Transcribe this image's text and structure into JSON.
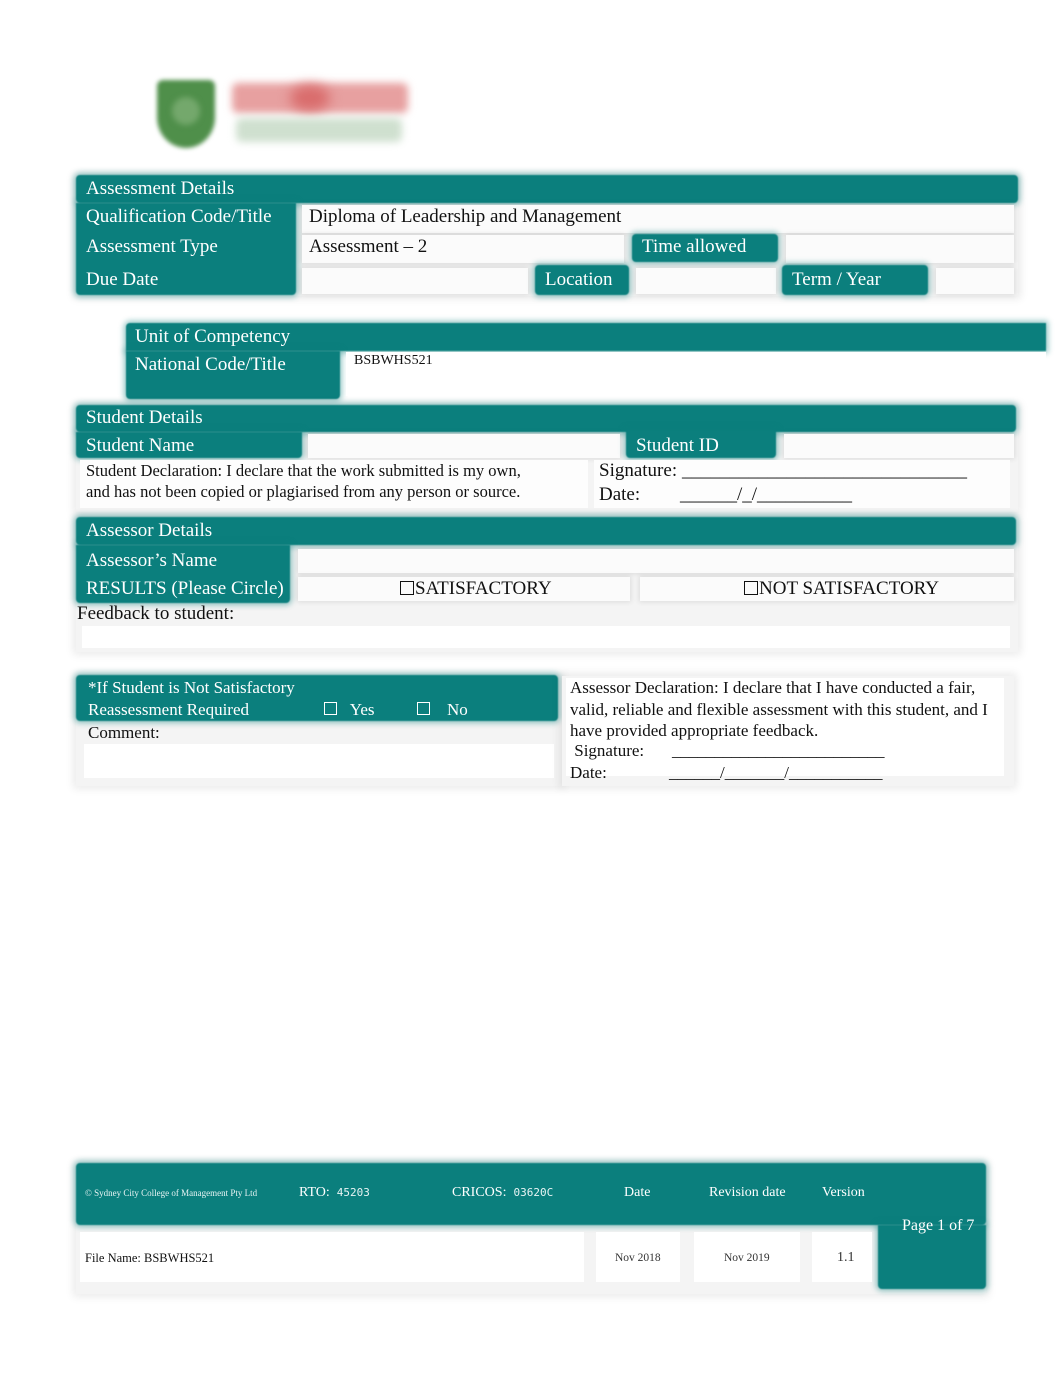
{
  "logo": {
    "name": "Sydney City College of Management logo",
    "icon": "shield-crest-icon"
  },
  "colors": {
    "accent": "#0b7f7d",
    "text": "#111111",
    "header_text": "#ffffff"
  },
  "assessment_details": {
    "heading": "Assessment Details",
    "qualification_label": "Qualification Code/Title",
    "qualification_value": "Diploma of Leadership and Management",
    "type_label": "Assessment Type",
    "type_value": "Assessment – 2",
    "time_allowed_label": "Time allowed",
    "time_allowed_value": "",
    "due_date_label": "Due Date",
    "due_date_value": "",
    "location_label": "Location",
    "location_value": "",
    "term_year_label": "Term / Year",
    "term_year_value": ""
  },
  "unit_of_competency": {
    "heading": "Unit of Competency",
    "code_label": "National Code/Title",
    "code_value": "BSBWHS521"
  },
  "student_details": {
    "heading": "Student Details",
    "name_label": "Student Name",
    "name_value": "",
    "id_label": "Student ID",
    "id_value": "",
    "declaration_line1": "Student Declaration:   I declare that the work submitted is my own,",
    "declaration_line2": "and has not been copied or plagiarised from any person or source.",
    "signature_label": "Signature:",
    "signature_line": "______________________________",
    "date_label": "Date:",
    "date_line": "______/_/__________"
  },
  "assessor_details": {
    "heading": "Assessor Details",
    "name_label": "Assessor’s Name",
    "name_value": "",
    "results_label": "RESULTS (Please Circle)",
    "satisfactory_label": "SATISFACTORY",
    "not_satisfactory_label": "NOT SATISFACTORY",
    "feedback_label": "Feedback to student:",
    "feedback_value": ""
  },
  "reassessment": {
    "line1": "*If Student is Not Satisfactory",
    "line2": "Reassessment Required",
    "yes_label": "Yes",
    "no_label": "No",
    "comment_label": "Comment:",
    "comment_value": ""
  },
  "assessor_declaration": {
    "line1": "Assessor Declaration:   I declare that I have conducted a fair,",
    "line2": "valid, reliable and flexible assessment with this student, and I",
    "line3": "have provided appropriate feedback.",
    "signature_label": " Signature:",
    "signature_line": "_________________________",
    "date_label": "Date:",
    "date_line": "______/_______/___________"
  },
  "footer": {
    "copyright": "© Sydney City College of Management Pty Ltd",
    "rto_label": "RTO:",
    "rto_value": "45203",
    "cricos_label": "CRICOS:",
    "cricos_value": "03620C",
    "date_header": "Date",
    "revision_header": "Revision date",
    "version_header": "Version",
    "page_label": "Page 1 of 7",
    "file_name": "File Name: BSBWHS521",
    "date_value": "Nov 2018",
    "revision_value": "Nov 2019",
    "version_value": "1.1"
  }
}
